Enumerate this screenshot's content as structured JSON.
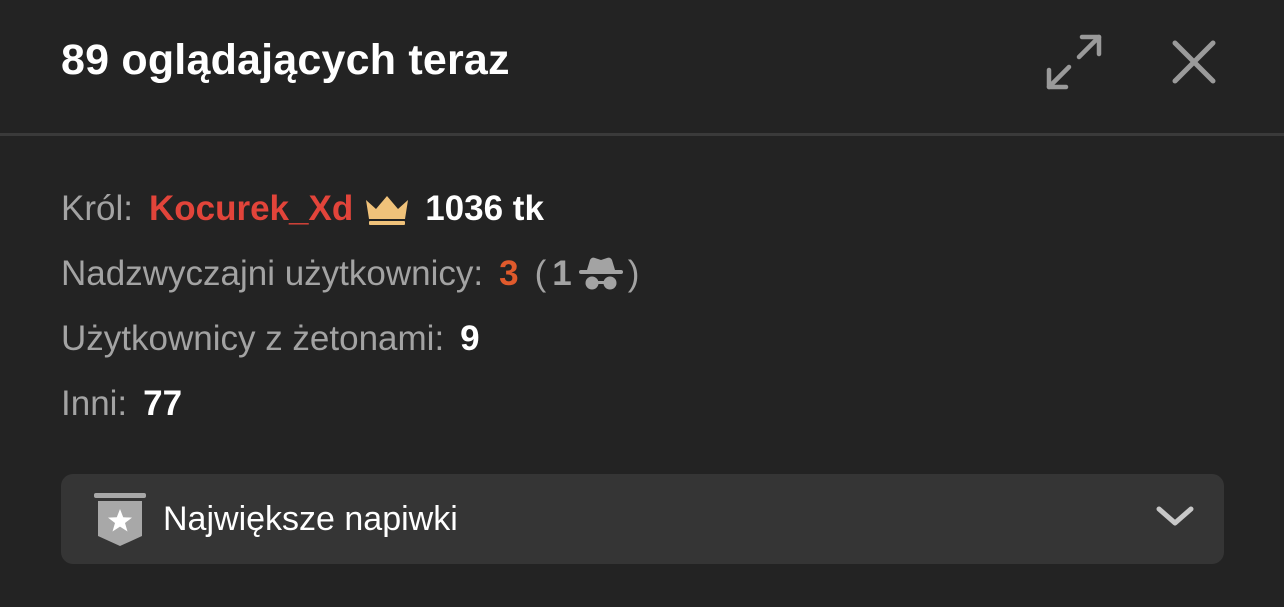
{
  "header": {
    "title": "89 oglądających teraz",
    "expand_icon": "expand-arrows-icon",
    "close_icon": "close-icon"
  },
  "stats": {
    "king": {
      "label": "Król:",
      "name": "Kocurek_Xd",
      "tokens": "1036 tk",
      "name_color": "#e2443a",
      "crown_color": "#f0c27a"
    },
    "special_users": {
      "label": "Nadzwyczajni użytkownicy:",
      "count": "3",
      "count_color": "#e05a2c",
      "anon_open": "(",
      "anon_count": "1",
      "anon_icon": "incognito-spy-icon",
      "anon_close": ")"
    },
    "token_users": {
      "label": "Użytkownicy z żetonami:",
      "count": "9"
    },
    "others": {
      "label": "Inni:",
      "count": "77"
    }
  },
  "dropdown": {
    "label": "Największe napiwki",
    "icon": "star-badge-icon",
    "chevron": "chevron-down-icon"
  }
}
